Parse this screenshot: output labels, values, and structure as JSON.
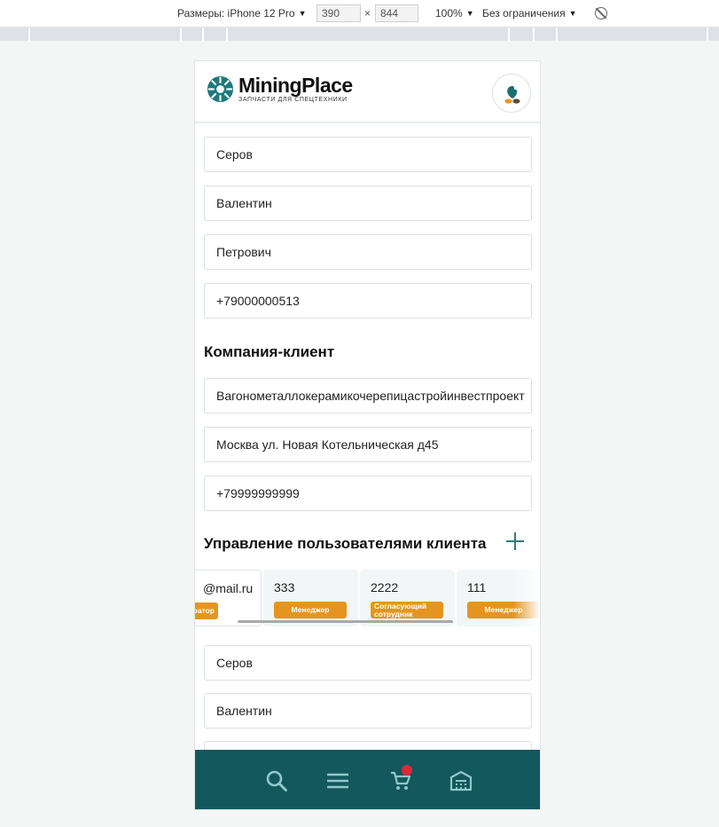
{
  "devtools": {
    "size_label": "Размеры: iPhone 12 Pro",
    "width": "390",
    "height": "844",
    "times": "×",
    "zoom": "100%",
    "throttle": "Без ограничения"
  },
  "header": {
    "logo_title": "MiningPlace",
    "logo_subtitle": "ЗАПЧАСТИ ДЛЯ СПЕЦТЕХНИКИ"
  },
  "user_fields": [
    "Серов",
    "Валентин",
    "Петрович",
    "+79000000513"
  ],
  "company": {
    "title": "Компания-клиент",
    "fields": [
      "Вагонометаллокерамикочерепицастройинвестпроект",
      "Москва ул. Новая Котельническая д45",
      "+79999999999"
    ]
  },
  "users_management": {
    "title": "Управление пользователями клиента",
    "cards": [
      {
        "email": "@mail.ru",
        "role": "истратор"
      },
      {
        "email": "333",
        "role": "Менеджер"
      },
      {
        "email": "2222",
        "role": "Согласующий сотрудник"
      },
      {
        "email": "111",
        "role": "Менеджер"
      }
    ]
  },
  "user_fields_2": [
    "Серов",
    "Валентин"
  ],
  "nav": {
    "items": [
      "search-icon",
      "menu-icon",
      "cart-icon",
      "warehouse-icon"
    ],
    "accent_color": "#12585d",
    "badge_color": "#e0283b"
  }
}
